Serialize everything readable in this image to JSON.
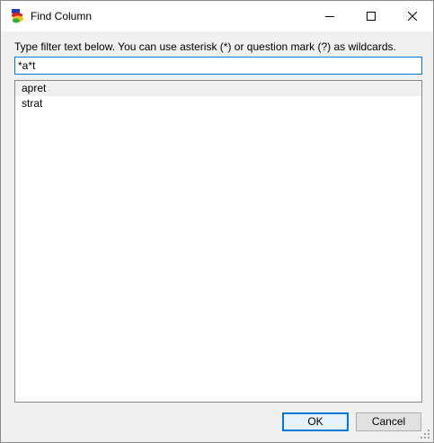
{
  "window": {
    "title": "Find Column",
    "app_icon": "colored-layers-icon",
    "controls": {
      "minimize_icon": "minimize-icon",
      "maximize_icon": "maximize-icon",
      "close_icon": "close-icon"
    }
  },
  "dialog": {
    "instructions": "Type filter text below. You can use asterisk (*) or question mark (?) as wildcards.",
    "filter": {
      "value": "*a*t",
      "placeholder": ""
    },
    "results": [
      {
        "label": "apret",
        "selected": true
      },
      {
        "label": "strat",
        "selected": false
      }
    ],
    "buttons": {
      "ok_label": "OK",
      "cancel_label": "Cancel"
    }
  },
  "colors": {
    "accent": "#0078d7",
    "selection": "#f0f0f0",
    "window_bg": "#f0f0f0"
  }
}
